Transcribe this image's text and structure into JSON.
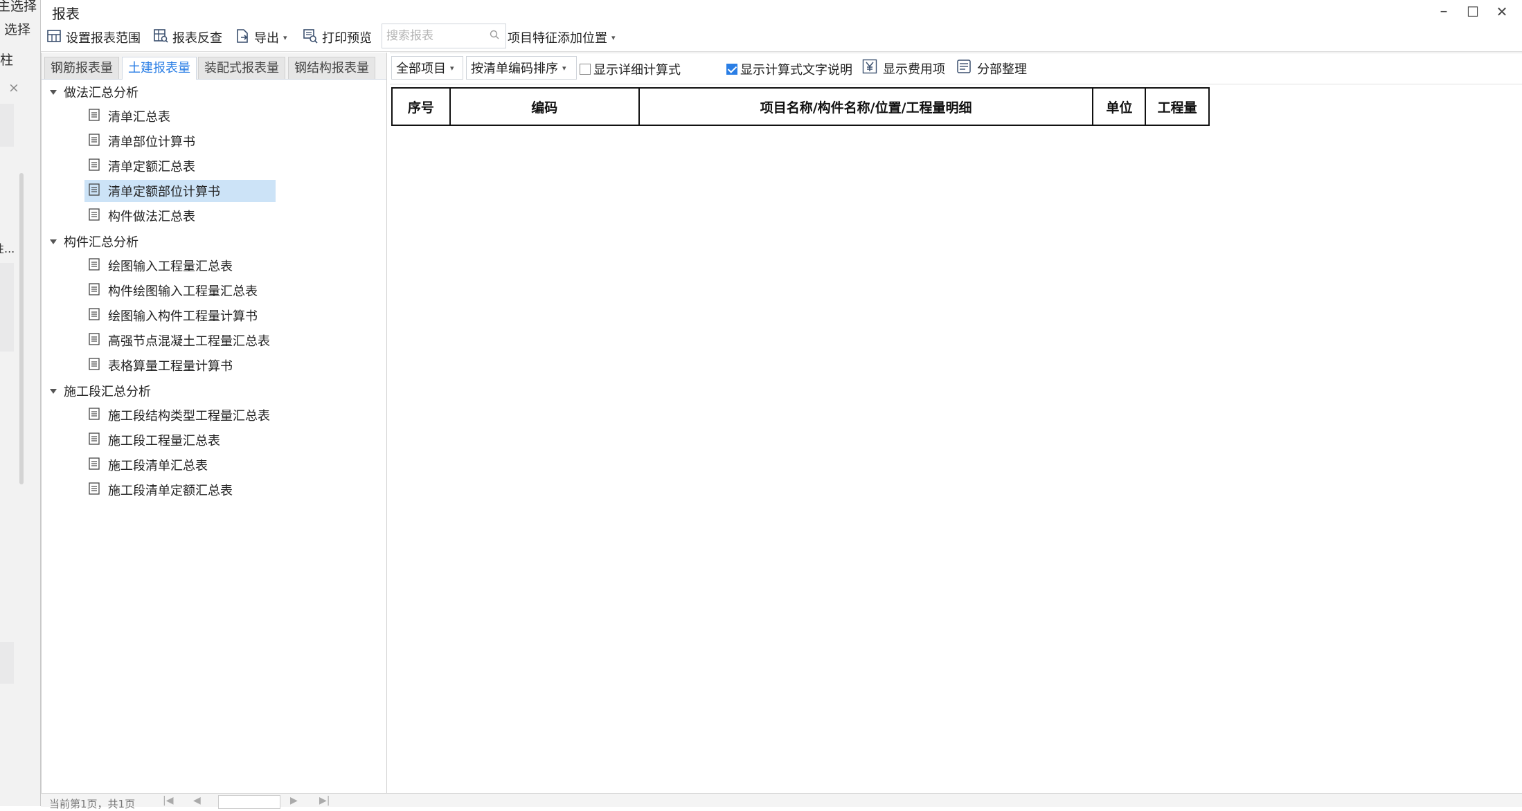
{
  "background_app": {
    "text1": "主选择",
    "text2": "选择",
    "text3": "柱",
    "close": "×",
    "ellipsis": "性..."
  },
  "window": {
    "title": "报表",
    "minimize": "–",
    "maximize": "☐",
    "close": "✕"
  },
  "toolbar": {
    "set_range": "设置报表范围",
    "reverse_check": "报表反查",
    "export": "导出",
    "print_preview": "打印预览",
    "search_placeholder": "搜索报表",
    "feature_position": "项目特征添加位置"
  },
  "tabs": [
    {
      "label": "钢筋报表量",
      "active": false
    },
    {
      "label": "土建报表量",
      "active": true
    },
    {
      "label": "装配式报表量",
      "active": false
    },
    {
      "label": "钢结构报表量",
      "active": false
    }
  ],
  "tree": {
    "groups": [
      {
        "label": "做法汇总分析",
        "items": [
          "清单汇总表",
          "清单部位计算书",
          "清单定额汇总表",
          "清单定额部位计算书",
          "构件做法汇总表"
        ]
      },
      {
        "label": "构件汇总分析",
        "items": [
          "绘图输入工程量汇总表",
          "构件绘图输入工程量汇总表",
          "绘图输入构件工程量计算书",
          "高强节点混凝土工程量汇总表",
          "表格算量工程量计算书"
        ]
      },
      {
        "label": "施工段汇总分析",
        "items": [
          "施工段结构类型工程量汇总表",
          "施工段工程量汇总表",
          "施工段清单汇总表",
          "施工段清单定额汇总表"
        ]
      }
    ],
    "selected_item": "清单定额部位计算书"
  },
  "report_toolbar": {
    "scope_select": "全部项目",
    "sort_select": "按清单编码排序",
    "show_detail_formula": {
      "label": "显示详细计算式",
      "checked": false
    },
    "show_formula_text": {
      "label": "显示计算式文字说明",
      "checked": true
    },
    "show_fee": "显示费用项",
    "section_arrange": "分部整理"
  },
  "report_table": {
    "columns": [
      "序号",
      "编码",
      "项目名称/构件名称/位置/工程量明细",
      "单位",
      "工程量"
    ]
  },
  "pager": {
    "text": "当前第1页，共1页"
  },
  "colors": {
    "accent": "#2a7ee5",
    "selection": "#cce3f7"
  }
}
